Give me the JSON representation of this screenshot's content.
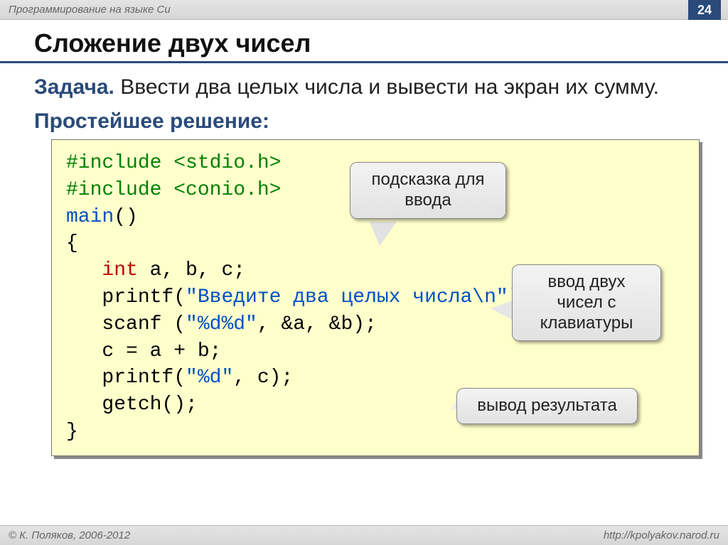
{
  "header": {
    "course": "Программирование на языке Си",
    "page": "24"
  },
  "title": "Сложение двух чисел",
  "task": {
    "label": "Задача.",
    "text": " Ввести два целых числа и вывести на экран их сумму."
  },
  "subhead": "Простейшее решение:",
  "code": {
    "l1a": "#include <stdio.h>",
    "l2a": "#include <conio.h>",
    "l3a": "main",
    "l3b": "()",
    "l4": "{",
    "l5a": "   ",
    "l5b": "int",
    "l5c": " a, b, c;",
    "l6a": "   printf(",
    "l6b": "\"Введите два целых числа\\n\"",
    "l6c": ");",
    "l7a": "   scanf (",
    "l7b": "\"%d%d\"",
    "l7c": ", &a, &b);",
    "l8": "   c = a + b;",
    "l9a": "   printf(",
    "l9b": "\"%d\"",
    "l9c": ", c);",
    "l10": "   getch();",
    "l11": "}"
  },
  "callouts": {
    "c1": "подсказка для ввода",
    "c2": "ввод двух чисел с клавиатуры",
    "c3": "вывод результата"
  },
  "footer": {
    "left": "© К. Поляков, 2006-2012",
    "right": "http://kpolyakov.narod.ru"
  }
}
